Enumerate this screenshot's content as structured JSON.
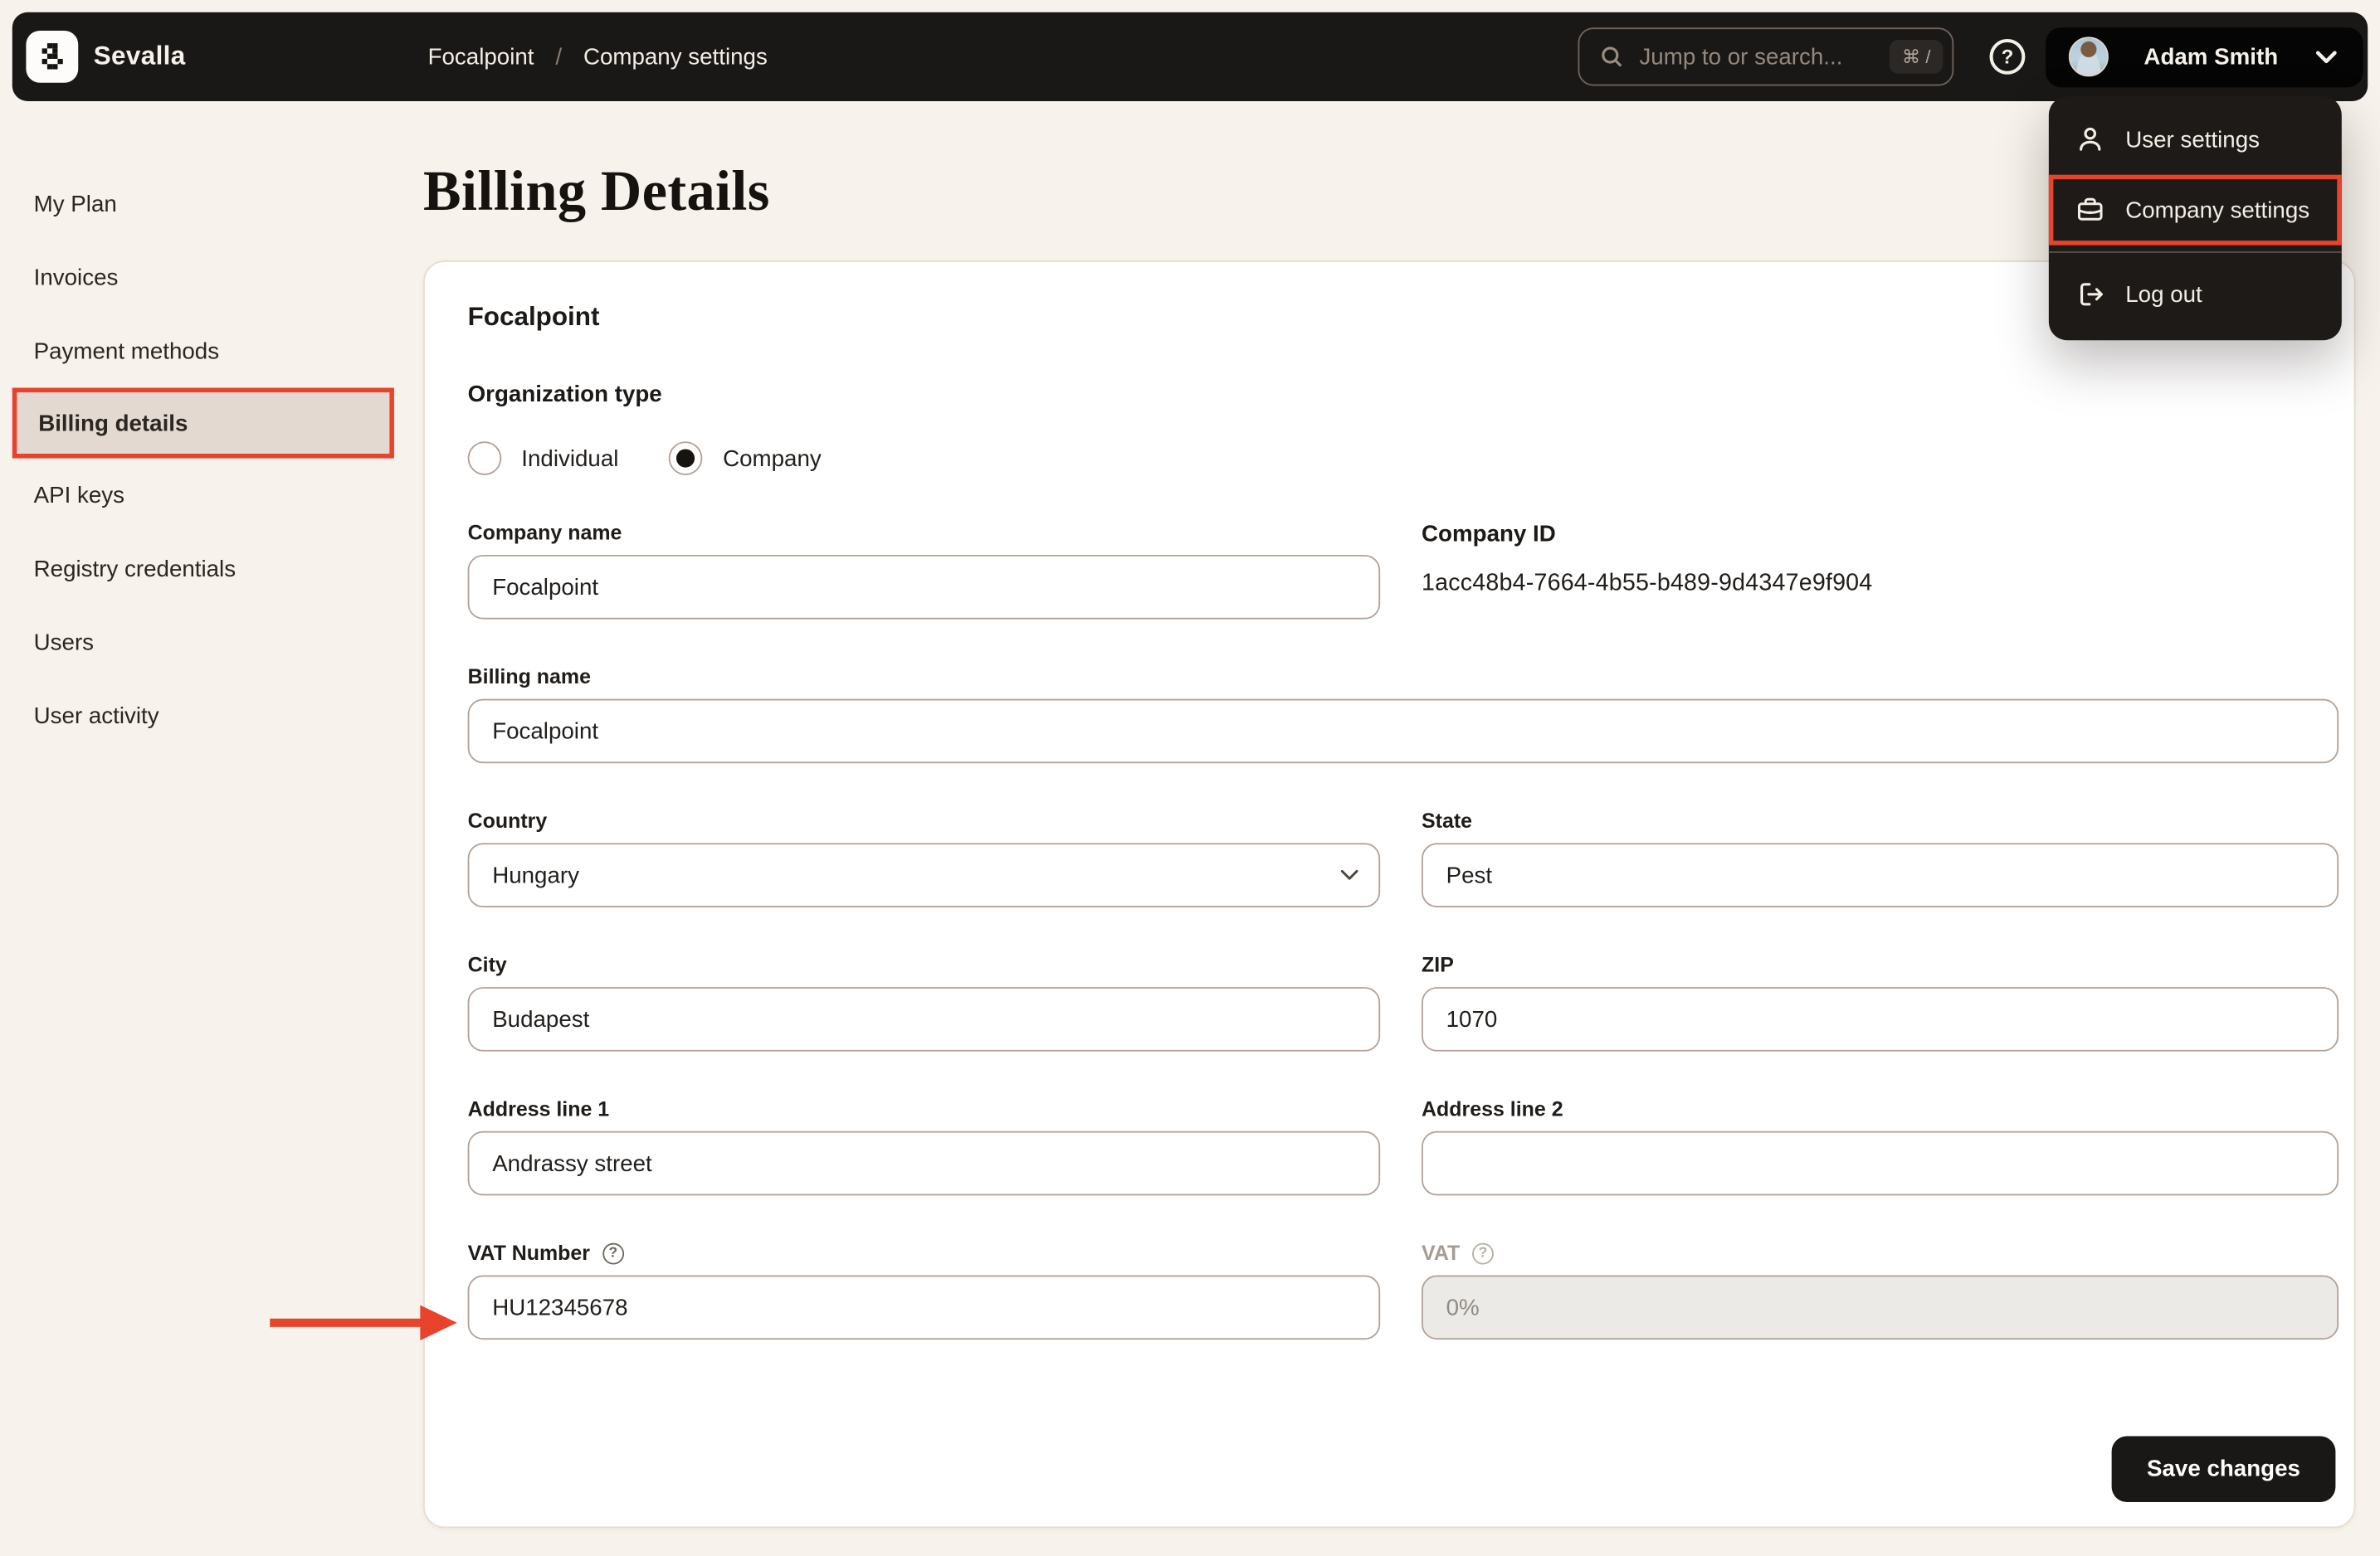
{
  "topbar": {
    "brand": "Sevalla",
    "breadcrumb": {
      "items": [
        "Focalpoint",
        "Company settings"
      ],
      "separator": "/"
    },
    "search": {
      "placeholder": "Jump to or search...",
      "shortcut": "⌘ /"
    },
    "user": {
      "name": "Adam Smith"
    }
  },
  "user_menu": {
    "items": [
      {
        "label": "User settings",
        "icon": "user-icon"
      },
      {
        "label": "Company settings",
        "icon": "briefcase-icon",
        "annotated": true
      },
      {
        "label": "Log out",
        "icon": "logout-icon"
      }
    ]
  },
  "sidebar": {
    "items": [
      {
        "label": "My Plan"
      },
      {
        "label": "Invoices"
      },
      {
        "label": "Payment methods"
      },
      {
        "label": "Billing details",
        "active": true
      },
      {
        "label": "API keys"
      },
      {
        "label": "Registry credentials"
      },
      {
        "label": "Users"
      },
      {
        "label": "User activity"
      }
    ]
  },
  "page": {
    "title": "Billing Details"
  },
  "form": {
    "card_title": "Focalpoint",
    "organization_type": {
      "label": "Organization type",
      "options": [
        {
          "label": "Individual",
          "selected": false
        },
        {
          "label": "Company",
          "selected": true
        }
      ]
    },
    "company_name": {
      "label": "Company name",
      "value": "Focalpoint"
    },
    "company_id": {
      "label": "Company ID",
      "value": "1acc48b4-7664-4b55-b489-9d4347e9f904"
    },
    "billing_name": {
      "label": "Billing name",
      "value": "Focalpoint"
    },
    "country": {
      "label": "Country",
      "value": "Hungary"
    },
    "state": {
      "label": "State",
      "value": "Pest"
    },
    "city": {
      "label": "City",
      "value": "Budapest"
    },
    "zip": {
      "label": "ZIP",
      "value": "1070"
    },
    "address1": {
      "label": "Address line 1",
      "value": "Andrassy street"
    },
    "address2": {
      "label": "Address line 2",
      "value": ""
    },
    "vat_number": {
      "label": "VAT Number",
      "value": "HU12345678"
    },
    "vat": {
      "label": "VAT",
      "value": "0%"
    },
    "save_label": "Save changes"
  },
  "colors": {
    "accent_red": "#e8432c",
    "topbar_bg": "#1a1816",
    "page_bg": "#f7f2eb",
    "active_item_bg": "#e3d9d1",
    "input_border": "#b3a399"
  }
}
